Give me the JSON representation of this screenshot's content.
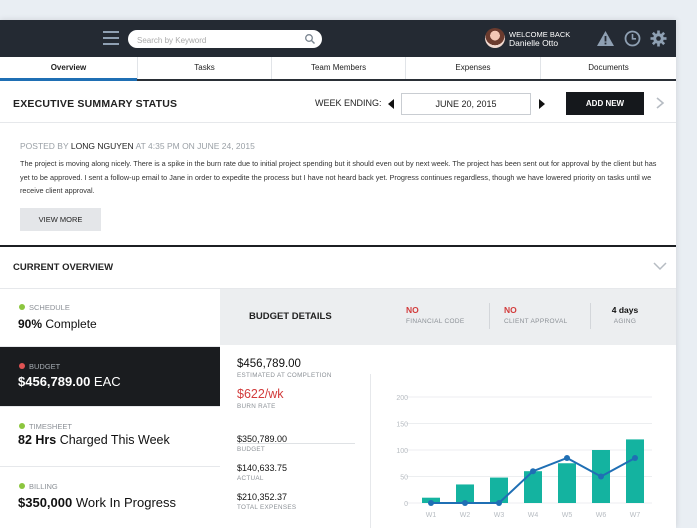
{
  "header": {
    "search_placeholder": "Search by Keyword",
    "welcome_label": "WELCOME BACK",
    "user_name": "Danielle Otto",
    "icons": [
      "menu-icon",
      "search-icon",
      "alert-icon",
      "clock-icon",
      "gear-icon"
    ]
  },
  "tabs": [
    {
      "label": "Overview",
      "active": true
    },
    {
      "label": "Tasks",
      "active": false
    },
    {
      "label": "Team Members",
      "active": false
    },
    {
      "label": "Expenses",
      "active": false
    },
    {
      "label": "Documents",
      "active": false
    }
  ],
  "exec": {
    "title": "EXECUTIVE SUMMARY STATUS",
    "week_label": "WEEK ENDING:",
    "week_date": "JUNE 20, 2015",
    "add_new": "ADD NEW",
    "posted_prefix": "POSTED BY",
    "author": "LONG NGUYEN",
    "posted_suffix": "AT 4:35 PM ON JUNE 24, 2015",
    "body": "The project is moving along nicely. There is a spike in the burn rate due to initial project spending but it should even out by next week. The project has been sent out for approval by the client but has yet to be approved. I sent a follow-up email to Jane in order to expedite the process but I have not heard back yet. Progress continues regardless, though we have lowered priority on tasks until we receive client approval.",
    "view_more": "VIEW MORE"
  },
  "overview": {
    "title": "CURRENT OVERVIEW",
    "items": [
      {
        "label": "SCHEDULE",
        "value_bold": "90%",
        "value_rest": " Complete",
        "dot": "#8cc63f",
        "active": false
      },
      {
        "label": "BUDGET",
        "value_bold": "$456,789.00",
        "value_rest": " EAC",
        "dot": "#e05353",
        "active": true
      },
      {
        "label": "TIMESHEET",
        "value_bold": "82 Hrs",
        "value_rest": " Charged This Week",
        "dot": "#8cc63f",
        "active": false
      },
      {
        "label": "BILLING",
        "value_bold": "$350,000",
        "value_rest": " Work In Progress",
        "dot": "#8cc63f",
        "active": false
      }
    ]
  },
  "budget": {
    "title": "BUDGET DETAILS",
    "financial_code": {
      "value": "NO",
      "label": "FINANCIAL CODE"
    },
    "client_approval": {
      "value": "NO",
      "label": "CLIENT APPROVAL"
    },
    "aging": {
      "value": "4 days",
      "label": "AGING"
    },
    "eac": {
      "value": "$456,789.00",
      "label": "ESTIMATED AT COMPLETION"
    },
    "burn": {
      "value": "$622/wk",
      "label": "BURN RATE"
    },
    "budget": {
      "value": "$350,789.00",
      "label": "BUDGET"
    },
    "actual": {
      "value": "$140,633.75",
      "label": "ACTUAL"
    },
    "total_expenses": {
      "value": "$210,352.37",
      "label": "TOTAL EXPENSES"
    }
  },
  "colors": {
    "accent": "#1f6fb4",
    "bar": "#14b3a0",
    "line": "#1f6fb4",
    "alert": "#d23b3b",
    "ok": "#8cc63f"
  },
  "chart_data": {
    "type": "bar",
    "categories": [
      "W1",
      "W2",
      "W3",
      "W4",
      "W5",
      "W6",
      "W7"
    ],
    "series": [
      {
        "values": [
          10,
          35,
          48,
          60,
          75,
          100,
          120
        ]
      },
      {
        "values": [
          0,
          0,
          0,
          60,
          85,
          50,
          85
        ]
      }
    ],
    "yticks": [
      0,
      50,
      100,
      150,
      200
    ],
    "ylim": [
      0,
      200
    ],
    "grid": true
  }
}
